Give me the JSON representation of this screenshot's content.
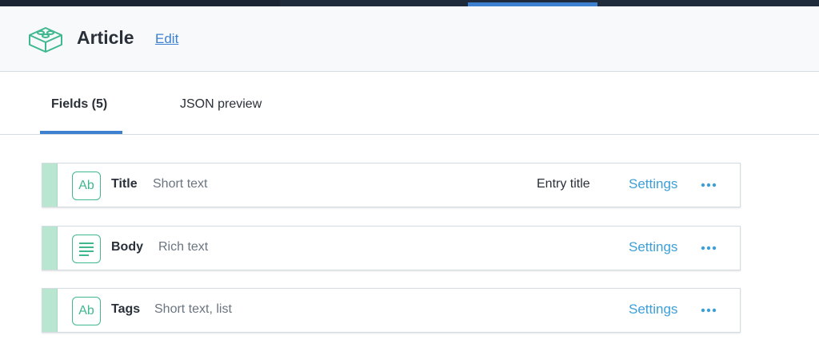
{
  "header": {
    "title": "Article",
    "edit_label": "Edit",
    "logo_icon": "content-model-blocks-icon"
  },
  "tabs": [
    {
      "label": "Fields (5)",
      "active": true
    },
    {
      "label": "JSON preview",
      "active": false
    }
  ],
  "fields": [
    {
      "name": "Title",
      "type": "Short text",
      "extra": "Entry title",
      "icon": "short-text-icon",
      "icon_text": "Ab",
      "settings_label": "Settings"
    },
    {
      "name": "Body",
      "type": "Rich text",
      "extra": "",
      "icon": "rich-text-icon",
      "icon_text": "",
      "settings_label": "Settings"
    },
    {
      "name": "Tags",
      "type": "Short text, list",
      "extra": "",
      "icon": "short-text-icon",
      "icon_text": "Ab",
      "settings_label": "Settings"
    }
  ],
  "colors": {
    "accent": "#3c80cf",
    "link": "#3c9fd8",
    "green": "#3fb88e",
    "handle": "#b8e6d1"
  }
}
